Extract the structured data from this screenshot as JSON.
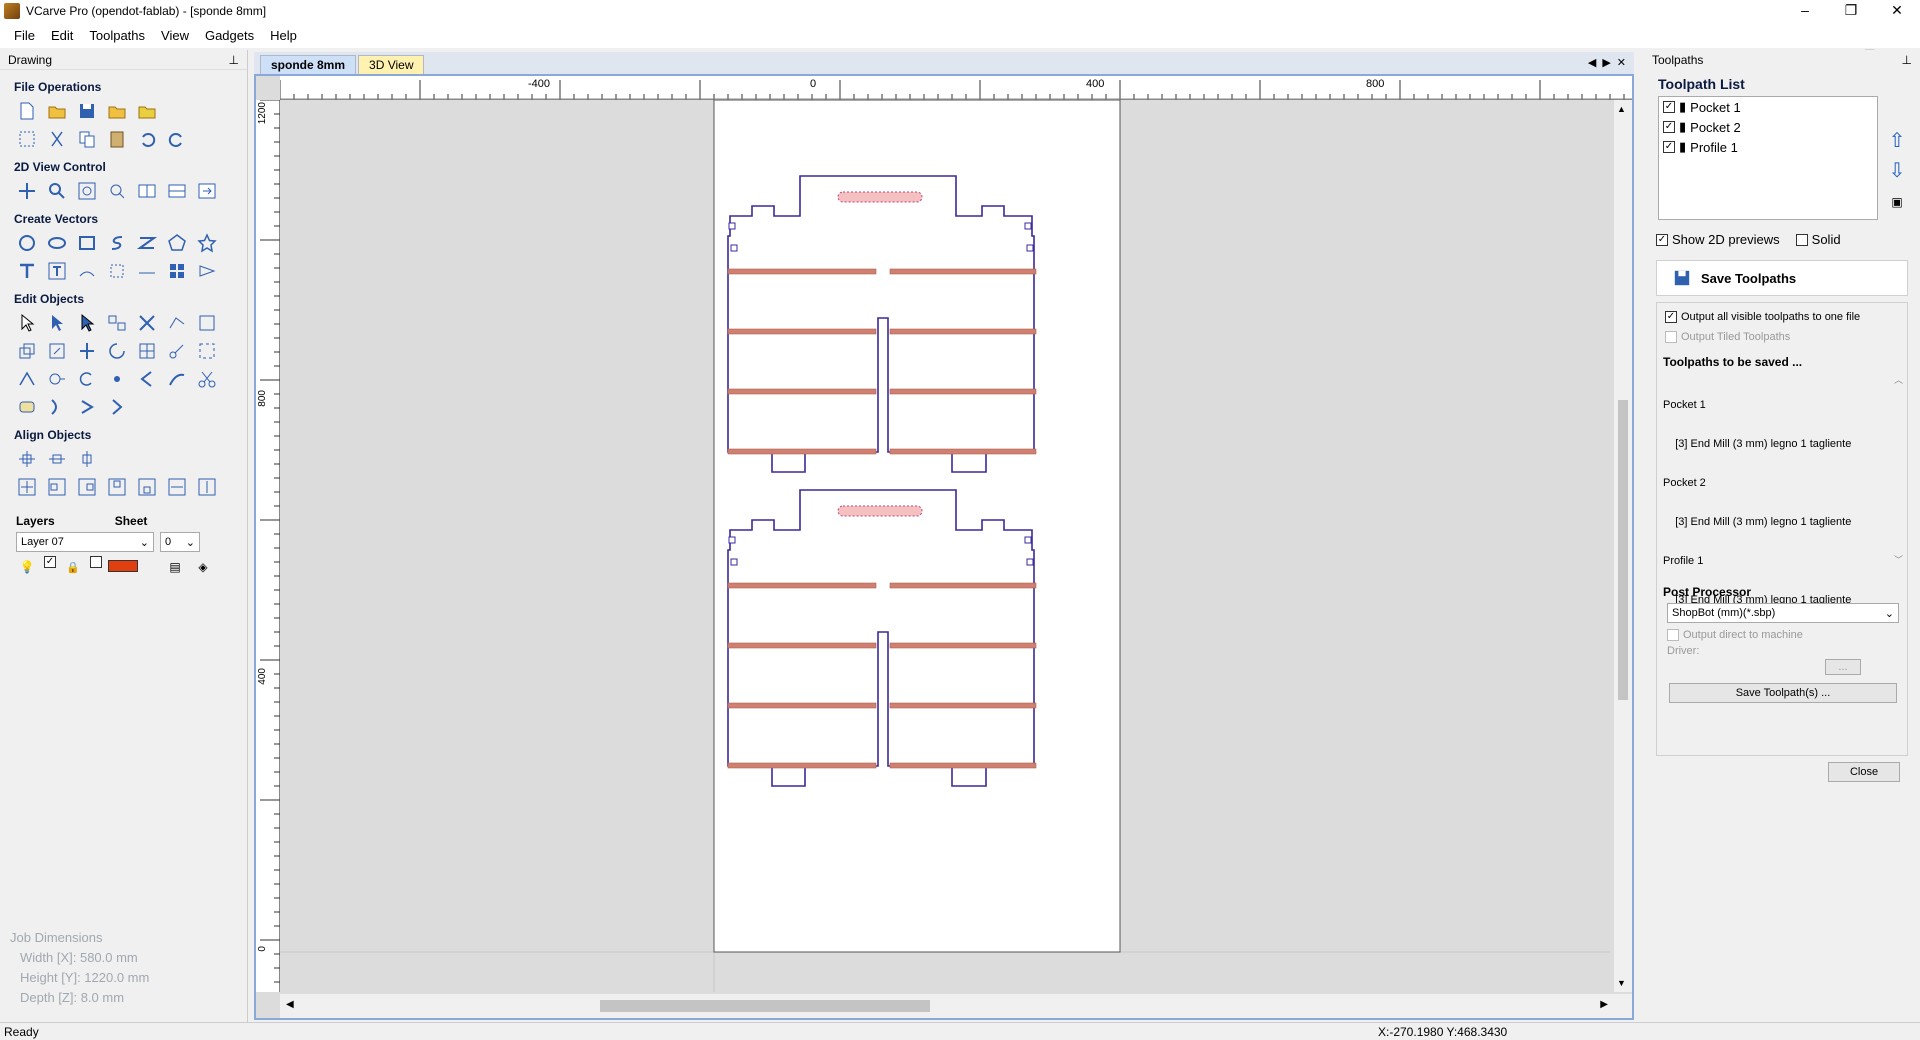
{
  "window": {
    "title": "VCarve Pro (opendot-fablab) - [sponde 8mm]",
    "controls": [
      "–",
      "❐",
      "✕"
    ]
  },
  "mdi_controls": [
    "–",
    "❐",
    "✕"
  ],
  "menu": [
    "File",
    "Edit",
    "Toolpaths",
    "View",
    "Gadgets",
    "Help"
  ],
  "left_panel": {
    "title": "Drawing",
    "pin": "⊥",
    "sections": {
      "file_ops": "File Operations",
      "view_control": "2D View Control",
      "create_vectors": "Create Vectors",
      "edit_objects": "Edit Objects",
      "align_objects": "Align Objects"
    },
    "layers": {
      "title": "Layers",
      "sheet_title": "Sheet",
      "layer_value": "Layer 07",
      "sheet_value": "0"
    },
    "job_dims": {
      "title": "Job Dimensions",
      "width": "Width  [X]: 580.0 mm",
      "height": "Height [Y]: 1220.0 mm",
      "depth": "Depth  [Z]: 8.0 mm"
    }
  },
  "doc_tabs": {
    "active": "sponde 8mm",
    "other": "3D View",
    "nav": [
      "◀",
      "▶",
      "✕"
    ]
  },
  "ruler": {
    "h_labels": [
      "-400",
      "0",
      "400",
      "800"
    ],
    "v_labels": [
      "1200",
      "800",
      "400",
      "0"
    ]
  },
  "status": {
    "text": "Ready",
    "coords": "X:-270.1980 Y:468.3430"
  },
  "right_panel": {
    "title": "Toolpaths",
    "list_title": "Toolpath List",
    "toolpaths": [
      "Pocket 1",
      "Pocket 2",
      "Profile 1"
    ],
    "show_previews": "Show 2D previews",
    "solid": "Solid",
    "save_title": "Save Toolpaths",
    "output_all": "Output all visible toolpaths to one file",
    "output_tiled": "Output Tiled Toolpaths",
    "to_be_saved": "Toolpaths to be saved ...",
    "saved_lines": [
      "Pocket 1",
      "    [3] End Mill (3 mm) legno 1 tagliente",
      "Pocket 2",
      "    [3] End Mill (3 mm) legno 1 tagliente",
      "Profile 1",
      "    [3] End Mill (3 mm) legno 1 tagliente"
    ],
    "post_processor": "Post Processor",
    "pp_value": "ShopBot (mm)(*.sbp)",
    "output_direct": "Output direct to machine",
    "driver": "Driver:",
    "dots": "...",
    "save_btn": "Save Toolpath(s) ...",
    "close_btn": "Close"
  },
  "colors": {
    "accent": "#8aa8d8",
    "vector": "#3a2a9a",
    "pocket": "#d08070"
  }
}
